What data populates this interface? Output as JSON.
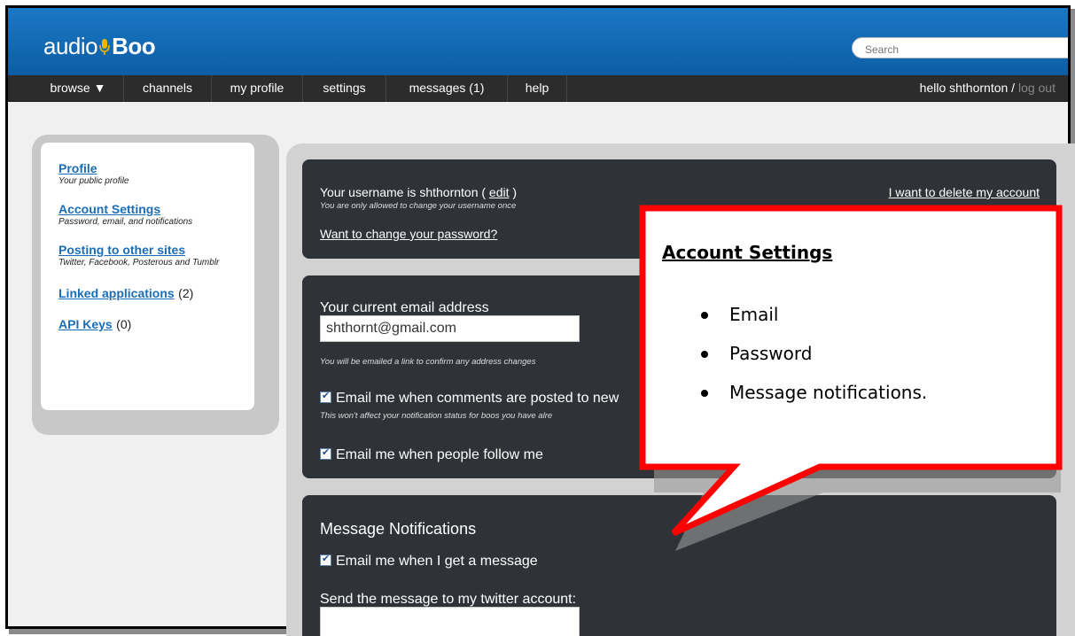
{
  "header": {
    "logo_left": "audio",
    "logo_right": "Boo",
    "search_placeholder": "Search"
  },
  "nav": {
    "items": [
      "browse ▼",
      "channels",
      "my profile",
      "settings",
      "messages (1)",
      "help"
    ],
    "greeting": "hello shthornton /",
    "logout": "log out"
  },
  "sidebar": {
    "items": [
      {
        "label": "Profile",
        "desc": "Your public profile"
      },
      {
        "label": "Account Settings",
        "desc": "Password, email, and notifications"
      },
      {
        "label": "Posting to other sites",
        "desc": "Twitter, Facebook, Posterous and Tumblr"
      },
      {
        "label": "Linked applications",
        "count": "(2)"
      },
      {
        "label": "API Keys",
        "count": "(0)"
      }
    ]
  },
  "username_panel": {
    "text": "Your username is shthornton (",
    "edit": "edit",
    "close_paren": ")",
    "note": "You are only allowed to change your username once",
    "change_password": "Want to change your password?",
    "delete_account": "I want to delete my account"
  },
  "email_panel": {
    "label": "Your current email address",
    "email_value": "shthornt@gmail.com",
    "note": "You will be emailed a link to confirm any address changes",
    "comments_checkbox": "Email me when comments are posted to new",
    "comments_note": "This won't affect your notification status for boos you have alre",
    "follow_checkbox": "Email me when people follow me"
  },
  "message_panel": {
    "title": "Message Notifications",
    "message_checkbox": "Email me when I get a message",
    "twitter_label": "Send the message to my twitter account:"
  },
  "callout": {
    "title": "Account Settings",
    "items": [
      "Email",
      "Password",
      "Message notifications."
    ]
  },
  "colors": {
    "header_blue": "#1568b0",
    "nav_dark": "#2c2c2c",
    "panel_dark": "#2f3338",
    "link_blue": "#1a6db6",
    "callout_red": "#ff0000"
  }
}
